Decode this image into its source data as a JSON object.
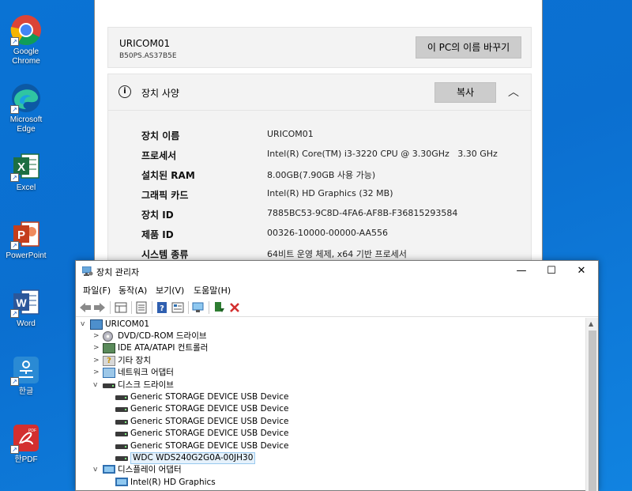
{
  "desktop": {
    "icons": [
      {
        "label": "Google Chrome",
        "icon": "chrome-icon"
      },
      {
        "label": "Microsoft Edge",
        "icon": "edge-icon"
      },
      {
        "label": "Excel",
        "icon": "excel-icon"
      },
      {
        "label": "PowerPoint",
        "icon": "powerpoint-icon"
      },
      {
        "label": "Word",
        "icon": "word-icon"
      },
      {
        "label": "한글",
        "icon": "hangul-icon"
      },
      {
        "label": "한PDF",
        "icon": "hanpdf-icon"
      }
    ]
  },
  "settings": {
    "pc_name": "URICOM01",
    "pc_model": "B50PS.AS37B5E",
    "rename_button": "이 PC의 이름 바꾸기",
    "spec_title": "장치 사양",
    "copy_button": "복사",
    "specs": [
      {
        "key": "장치 이름",
        "value": "URICOM01"
      },
      {
        "key": "프로세서",
        "value": "Intel(R) Core(TM) i3-3220 CPU @ 3.30GHz   3.30 GHz"
      },
      {
        "key": "설치된 RAM",
        "value": "8.00GB(7.90GB 사용 가능)"
      },
      {
        "key": "그래픽 카드",
        "value": "Intel(R) HD Graphics (32 MB)"
      },
      {
        "key": "장치 ID",
        "value": "7885BC53-9C8D-4FA6-AF8B-F36815293584"
      },
      {
        "key": "제품 ID",
        "value": "00326-10000-00000-AA556"
      },
      {
        "key": "시스템 종류",
        "value": "64비트 운영 체제, x64 기반 프로세서"
      }
    ]
  },
  "devmgr": {
    "title": "장치 관리자",
    "window_controls": {
      "minimize": "—",
      "maximize": "☐",
      "close": "✕"
    },
    "menu": [
      "파일(F)",
      "동작(A)",
      "보기(V)",
      "도움말(H)"
    ],
    "tree": {
      "root": "URICOM01",
      "nodes": [
        {
          "label": "DVD/CD-ROM 드라이브",
          "level": 1,
          "expander": ">",
          "icon": "disc"
        },
        {
          "label": "IDE ATA/ATAPI 컨트롤러",
          "level": 1,
          "expander": ">",
          "icon": "chip"
        },
        {
          "label": "기타 장치",
          "level": 1,
          "expander": ">",
          "icon": "qmark"
        },
        {
          "label": "네트워크 어댑터",
          "level": 1,
          "expander": ">",
          "icon": "net"
        },
        {
          "label": "디스크 드라이브",
          "level": 1,
          "expander": "v",
          "icon": "drive"
        },
        {
          "label": "Generic STORAGE DEVICE USB Device",
          "level": 2,
          "expander": "",
          "icon": "drive"
        },
        {
          "label": "Generic STORAGE DEVICE USB Device",
          "level": 2,
          "expander": "",
          "icon": "drive"
        },
        {
          "label": "Generic STORAGE DEVICE USB Device",
          "level": 2,
          "expander": "",
          "icon": "drive"
        },
        {
          "label": "Generic STORAGE DEVICE USB Device",
          "level": 2,
          "expander": "",
          "icon": "drive"
        },
        {
          "label": "Generic STORAGE DEVICE USB Device",
          "level": 2,
          "expander": "",
          "icon": "drive"
        },
        {
          "label": "WDC WDS240G2G0A-00JH30",
          "level": 2,
          "expander": "",
          "icon": "drive",
          "selected": true
        },
        {
          "label": "디스플레이 어댑터",
          "level": 1,
          "expander": "v",
          "icon": "monitor"
        },
        {
          "label": "Intel(R) HD Graphics",
          "level": 2,
          "expander": "",
          "icon": "monitor"
        }
      ]
    }
  }
}
